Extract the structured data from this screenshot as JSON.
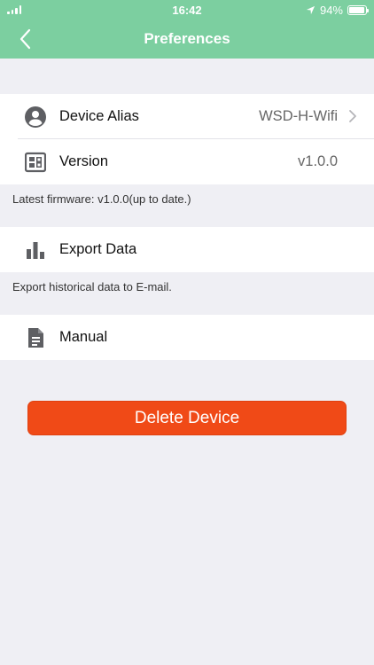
{
  "status_bar": {
    "time": "16:42",
    "battery": "94%",
    "battery_level": 0.94
  },
  "nav": {
    "title": "Preferences"
  },
  "device_group": {
    "alias": {
      "label": "Device Alias",
      "value": "WSD-H-Wifi",
      "icon": "user-circle-icon"
    },
    "version": {
      "label": "Version",
      "value": "v1.0.0",
      "icon": "chip-icon"
    }
  },
  "firmware_note": "Latest firmware: v1.0.0(up to date.)",
  "export_group": {
    "label": "Export Data",
    "icon": "bar-chart-icon"
  },
  "export_note": "Export historical data to E-mail.",
  "manual_group": {
    "label": "Manual",
    "icon": "document-icon"
  },
  "delete_button": {
    "label": "Delete Device"
  },
  "colors": {
    "header": "#7ccfa0",
    "background": "#efeff4",
    "delete": "#f04a17",
    "icon": "#5e5f63"
  }
}
